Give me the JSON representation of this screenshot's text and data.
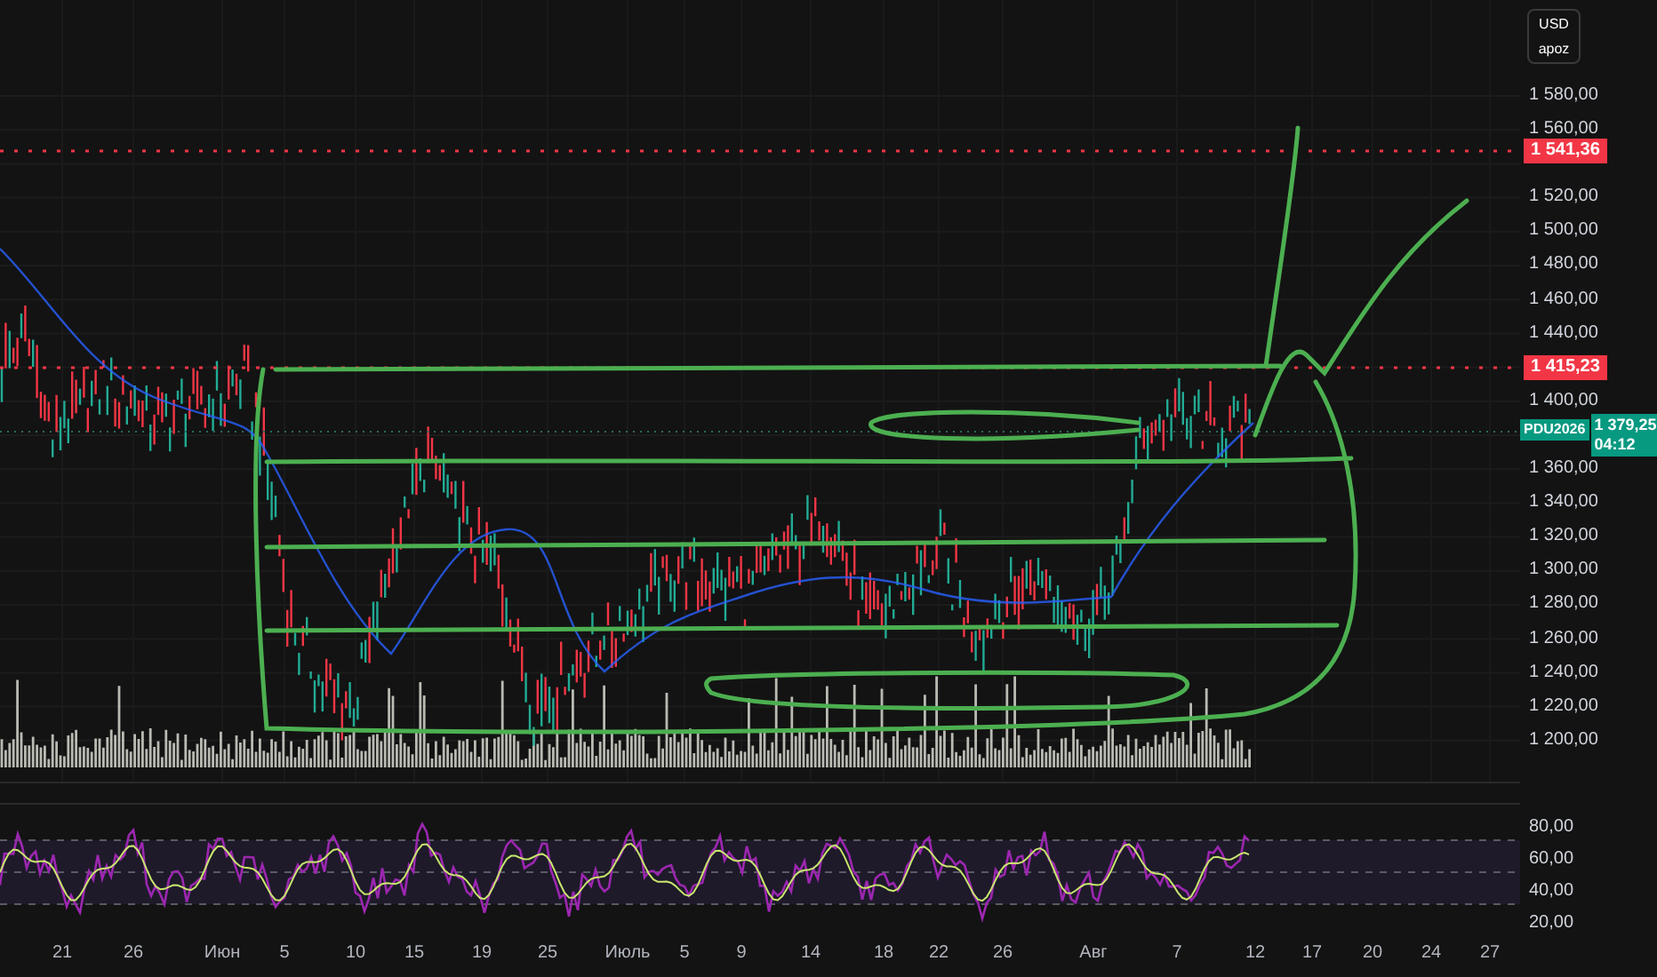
{
  "currency_menu": {
    "currency": "USD",
    "unit": "apoz"
  },
  "price_axis": {
    "ticks": [
      "1 580,00",
      "1 560,00",
      "1 520,00",
      "1 500,00",
      "1 480,00",
      "1 460,00",
      "1 440,00",
      "1 400,00",
      "1 360,00",
      "1 340,00",
      "1 320,00",
      "1 300,00",
      "1 280,00",
      "1 260,00",
      "1 240,00",
      "1 220,00",
      "1 200,00"
    ]
  },
  "price_tags": [
    {
      "kind": "level",
      "value": "1 541,36"
    },
    {
      "kind": "level",
      "value": "1 415,23"
    },
    {
      "kind": "last",
      "symbol": "PDU2026",
      "value": "1 379,25",
      "countdown": "04:12"
    }
  ],
  "rsi_axis": {
    "ticks": [
      "80,00",
      "60,00",
      "40,00",
      "20,00"
    ]
  },
  "time_axis": {
    "labels": [
      "21",
      "26",
      "Июн",
      "5",
      "10",
      "15",
      "19",
      "25",
      "Июль",
      "5",
      "9",
      "14",
      "18",
      "22",
      "26",
      "Авг",
      "7",
      "12",
      "17",
      "20",
      "24",
      "27"
    ]
  }
}
